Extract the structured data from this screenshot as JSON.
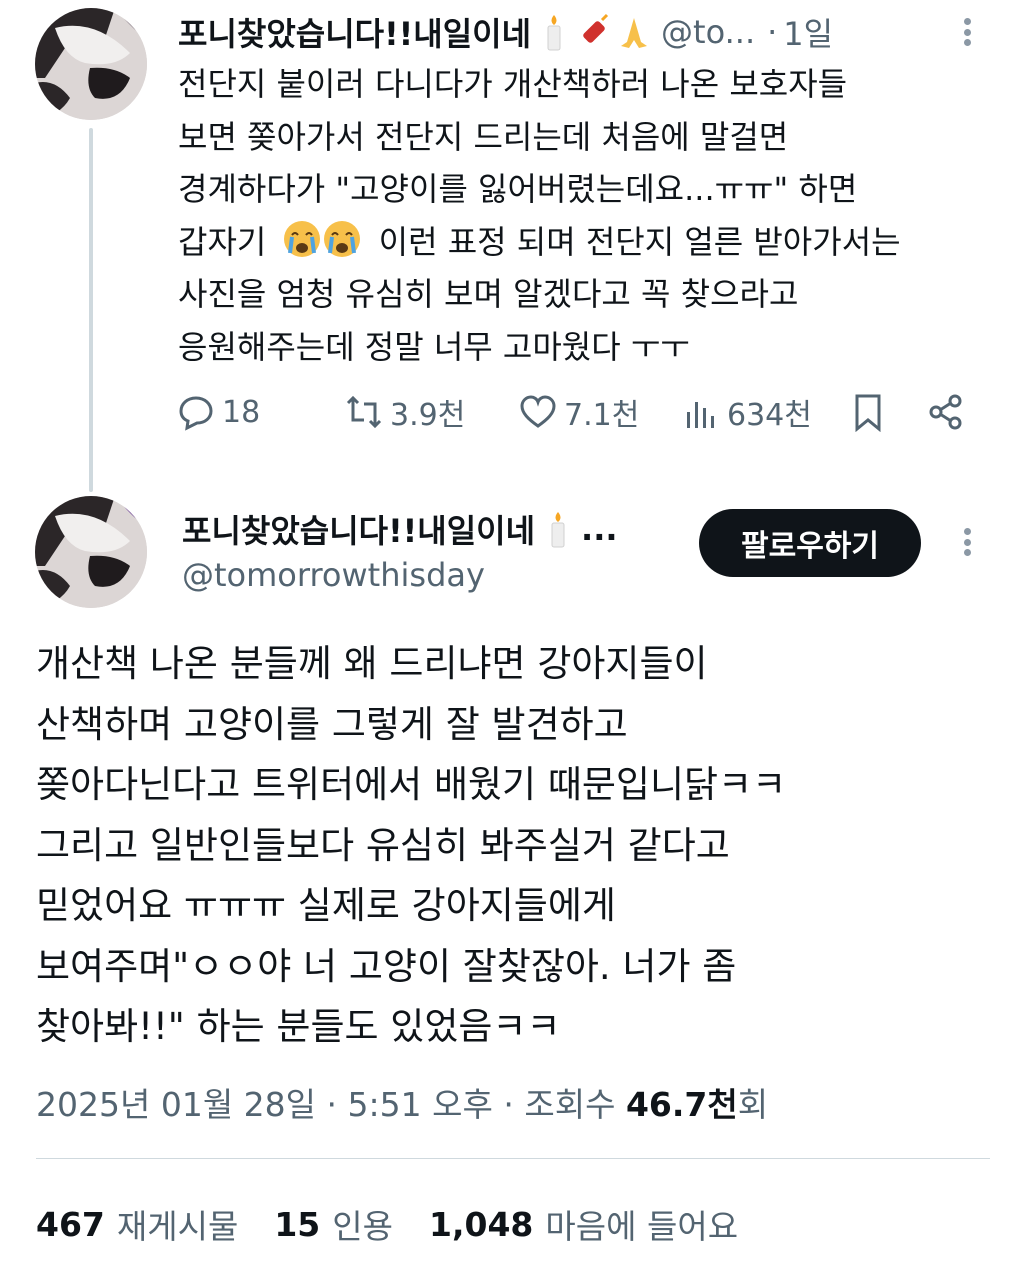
{
  "tweet1": {
    "display_name": "포니찾았습니다!!내일이네",
    "header_emojis": [
      "candle-icon",
      "firecracker-icon",
      "pray-icon"
    ],
    "handle": "@to...",
    "separator": "·",
    "time": "1일",
    "text_lines": [
      "전단지 붙이러 다니다가 개산책하러 나온 보호자들",
      "보면 쫒아가서 전단지 드리는데 처음에 말걸면",
      "경계하다가 \"고양이를 잃어버렸는데요...ㅠㅠ\" 하면",
      "갑자기",
      "이런 표정 되며 전단지 얼른 받아가서는",
      "사진을 엄청 유심히 보며 알겠다고 꼭 찾으라고",
      "응원해주는데 정말 너무 고마웠다 ㅜㅜ"
    ],
    "actions": {
      "reply_count": "18",
      "retweet_count": "3.9천",
      "like_count": "7.1천",
      "view_count": "634천"
    }
  },
  "tweet2": {
    "display_name": "포니찾았습니다!!내일이네",
    "name_suffix": "...",
    "handle": "@tomorrowthisday",
    "follow_label": "팔로우하기",
    "text_lines": [
      "개산책 나온 분들께 왜 드리냐면 강아지들이",
      "산책하며 고양이를 그렇게 잘 발견하고",
      "쫒아다닌다고 트위터에서 배웠기 때문입니닭ㅋㅋ",
      "그리고 일반인들보다 유심히 봐주실거 같다고",
      "믿었어요 ㅠㅠㅠ 실제로 강아지들에게",
      "보여주며\"ㅇㅇ야 너 고양이 잘찾잖아. 너가 좀",
      "찾아봐!!\" 하는 분들도 있었음ㅋㅋ"
    ],
    "meta": {
      "date": "2025년 01월 28일",
      "sep1": "·",
      "time": "5:51 오후",
      "sep2": "·",
      "views_label": "조회수",
      "views_value": "46.7천",
      "views_suffix": "회"
    },
    "stats": {
      "retweets": "467",
      "retweets_label": "재게시물",
      "quotes": "15",
      "quotes_label": "인용",
      "likes": "1,048",
      "likes_label": "마음에 들어요"
    }
  },
  "colors": {
    "text": "#0f1419",
    "muted": "#536471",
    "divider": "#cfd9de",
    "follow_bg": "#0f1419"
  }
}
